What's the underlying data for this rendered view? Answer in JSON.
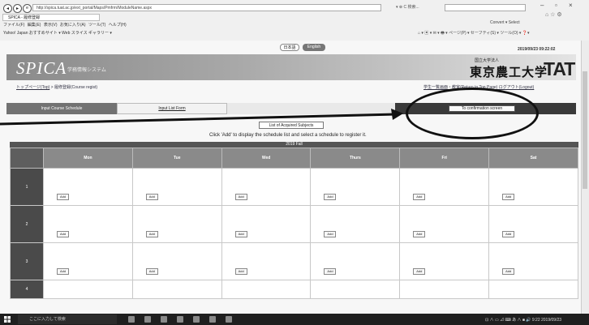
{
  "browser": {
    "address": "http://spica.tuat.ac.jp/ext_portal/Maps/Pmfrm/ModuleName.aspx",
    "tab_title": "SPICA - 履修登録",
    "address_controls": "▾ ⊕ C  検索...",
    "menubar": "ファイル(F) 編集(E) 表示(V) お気に入り(A) ツール(T) ヘルプ(H)",
    "favorites": "Yahoo! Japan  おすすめサイト ▾  Web スライス ギャラリー ▾",
    "toolbar_right": "⌂ ▾ ▣ ▾ ✉ ▾ 🖶 ▾ ページ(P) ▾ セーフティ(S) ▾ ツール(O) ▾ ❓▾",
    "top_right": "Convert ▾  Select"
  },
  "page": {
    "lang_ja": "日本語",
    "lang_en": "English",
    "datetime": "2019/09/23 09:22:02",
    "logo": "SPICA",
    "logo_sub": "学務情報システム",
    "univ_small": "国立大学法人",
    "univ_name": "東京農工大学",
    "univ_logo": "TAT",
    "breadcrumb_home": "トップページ(Top)",
    "breadcrumb_current": "履修登録(Course regist)",
    "toplinks": "学生一覧画面・教室(Return to Top Page) ログアウト(Logout)",
    "tab_course": "Input Course Schedule",
    "tab_entry": "Input List Form",
    "confirm_button": "To confirmation screen",
    "list_button": "List of Acquired Subjects",
    "instruction": "Click 'Add' to display the schedule list and select a schedule to register it.",
    "term": "2019 Fall"
  },
  "timetable": {
    "days": [
      "Mon",
      "Tue",
      "Wed",
      "Thurs",
      "Fri",
      "Sat"
    ],
    "periods": [
      "1",
      "2",
      "3",
      "4"
    ],
    "add_label": "Add"
  },
  "taskbar": {
    "search": "ここに入力して検索",
    "tray": "⊡ ∧ ▭ ⊿ ⌨ あ  ∧ ■ 🔊  9:22  2019/09/23"
  }
}
